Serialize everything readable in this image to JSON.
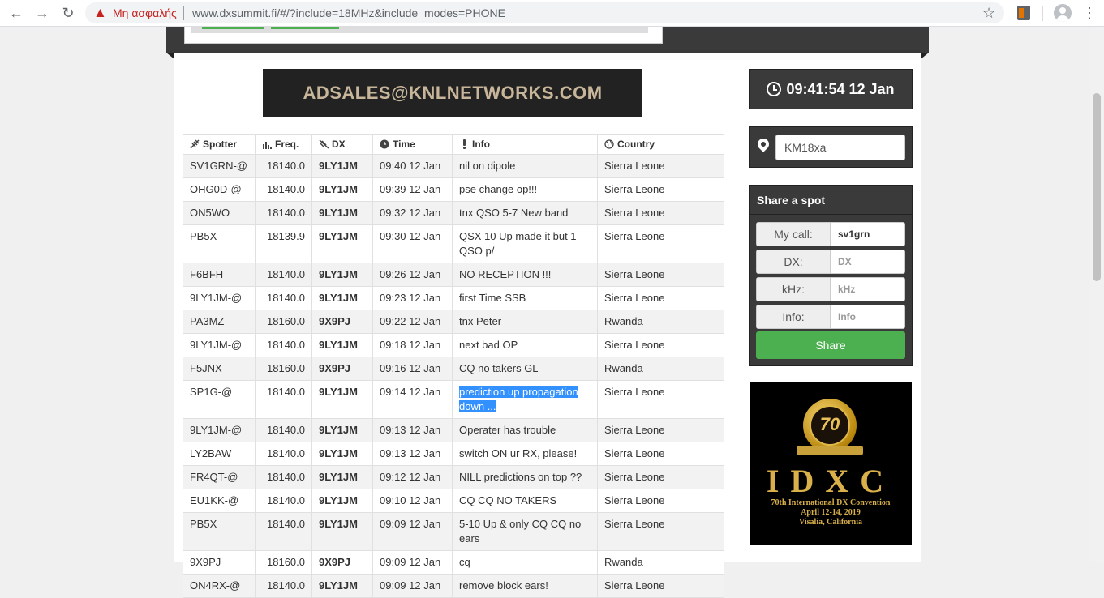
{
  "browser": {
    "not_secure": "Μη ασφαλής",
    "url": "www.dxsummit.fi/#/?include=18MHz&include_modes=PHONE",
    "back_icon": "arrow-left-icon",
    "forward_icon": "arrow-right-icon",
    "reload_icon": "reload-icon"
  },
  "ad": {
    "text": "ADSALES@KNLNETWORKS.COM"
  },
  "table": {
    "headers": {
      "spotter": "Spotter",
      "freq": "Freq.",
      "dx": "DX",
      "time": "Time",
      "info": "Info",
      "country": "Country"
    },
    "rows": [
      {
        "spotter": "SV1GRN-@",
        "freq": "18140.0",
        "dx": "9LY1JM",
        "time": "09:40 12 Jan",
        "info": "nil on dipole",
        "country": "Sierra Leone"
      },
      {
        "spotter": "OHG0D-@",
        "freq": "18140.0",
        "dx": "9LY1JM",
        "time": "09:39 12 Jan",
        "info": "pse change op!!!",
        "country": "Sierra Leone"
      },
      {
        "spotter": "ON5WO",
        "freq": "18140.0",
        "dx": "9LY1JM",
        "time": "09:32 12 Jan",
        "info": "tnx QSO 5-7 New band",
        "country": "Sierra Leone"
      },
      {
        "spotter": "PB5X",
        "freq": "18139.9",
        "dx": "9LY1JM",
        "time": "09:30 12 Jan",
        "info": "QSX 10 Up made it but 1 QSO p/",
        "country": "Sierra Leone"
      },
      {
        "spotter": "F6BFH",
        "freq": "18140.0",
        "dx": "9LY1JM",
        "time": "09:26 12 Jan",
        "info": "NO RECEPTION !!!",
        "country": "Sierra Leone"
      },
      {
        "spotter": "9LY1JM-@",
        "freq": "18140.0",
        "dx": "9LY1JM",
        "time": "09:23 12 Jan",
        "info": "first Time SSB",
        "country": "Sierra Leone"
      },
      {
        "spotter": "PA3MZ",
        "freq": "18160.0",
        "dx": "9X9PJ",
        "time": "09:22 12 Jan",
        "info": "tnx Peter",
        "country": "Rwanda"
      },
      {
        "spotter": "9LY1JM-@",
        "freq": "18140.0",
        "dx": "9LY1JM",
        "time": "09:18 12 Jan",
        "info": "next bad OP",
        "country": "Sierra Leone"
      },
      {
        "spotter": "F5JNX",
        "freq": "18160.0",
        "dx": "9X9PJ",
        "time": "09:16 12 Jan",
        "info": "CQ no takers GL",
        "country": "Rwanda"
      },
      {
        "spotter": "SP1G-@",
        "freq": "18140.0",
        "dx": "9LY1JM",
        "time": "09:14 12 Jan",
        "info": "prediction up propagation down ...",
        "country": "Sierra Leone"
      },
      {
        "spotter": "9LY1JM-@",
        "freq": "18140.0",
        "dx": "9LY1JM",
        "time": "09:13 12 Jan",
        "info": "Operater has trouble",
        "country": "Sierra Leone"
      },
      {
        "spotter": "LY2BAW",
        "freq": "18140.0",
        "dx": "9LY1JM",
        "time": "09:13 12 Jan",
        "info": "switch ON ur RX, please!",
        "country": "Sierra Leone"
      },
      {
        "spotter": "FR4QT-@",
        "freq": "18140.0",
        "dx": "9LY1JM",
        "time": "09:12 12 Jan",
        "info": "NILL predictions on top ??",
        "country": "Sierra Leone"
      },
      {
        "spotter": "EU1KK-@",
        "freq": "18140.0",
        "dx": "9LY1JM",
        "time": "09:10 12 Jan",
        "info": "CQ CQ NO TAKERS",
        "country": "Sierra Leone"
      },
      {
        "spotter": "PB5X",
        "freq": "18140.0",
        "dx": "9LY1JM",
        "time": "09:09 12 Jan",
        "info": "5-10 Up & only CQ CQ no ears",
        "country": "Sierra Leone"
      },
      {
        "spotter": "9X9PJ",
        "freq": "18160.0",
        "dx": "9X9PJ",
        "time": "09:09 12 Jan",
        "info": "cq",
        "country": "Rwanda"
      },
      {
        "spotter": "ON4RX-@",
        "freq": "18140.0",
        "dx": "9LY1JM",
        "time": "09:09 12 Jan",
        "info": "remove block ears!",
        "country": "Sierra Leone"
      }
    ]
  },
  "clock": {
    "time": "09:41:54 12 Jan"
  },
  "locator": {
    "value": "KM18xa"
  },
  "share": {
    "title": "Share a spot",
    "fields": [
      {
        "label": "My call:",
        "value": "sv1grn",
        "placeholder": ""
      },
      {
        "label": "DX:",
        "value": "",
        "placeholder": "DX"
      },
      {
        "label": "kHz:",
        "value": "",
        "placeholder": "kHz"
      },
      {
        "label": "Info:",
        "value": "",
        "placeholder": "Info"
      }
    ],
    "button": "Share"
  },
  "idxc": {
    "medal_number": "70",
    "letters": "IDXC",
    "line1": "70th International DX Convention",
    "line2": "April 12-14, 2019",
    "line3": "Visalia, California"
  },
  "colors": {
    "dark_panel": "#3a3a3a",
    "green": "#4caf50",
    "selection": "#3390ff",
    "warning": "#c5221f"
  }
}
